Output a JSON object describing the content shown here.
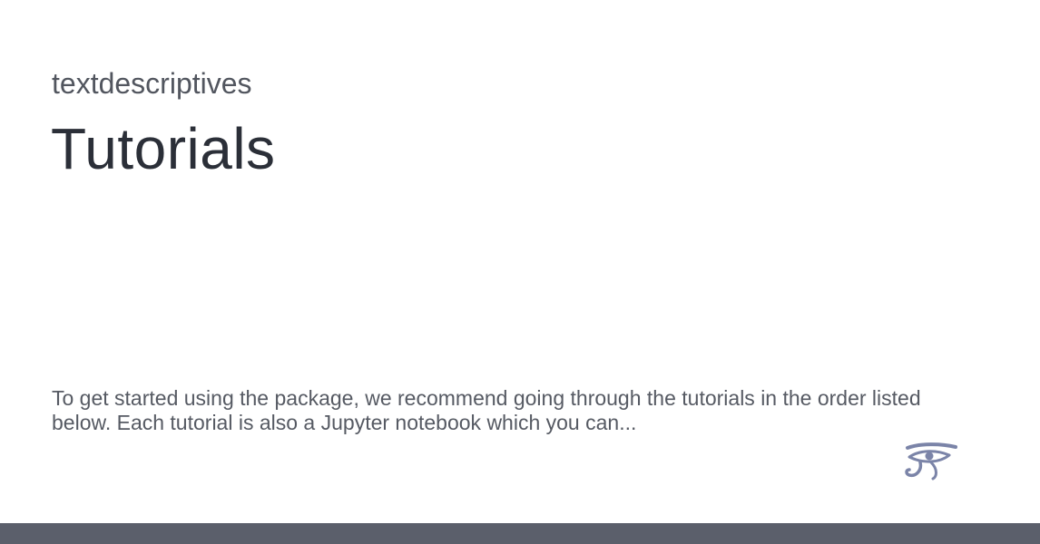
{
  "site": {
    "name": "textdescriptives"
  },
  "page": {
    "title": "Tutorials",
    "description": "To get started using the package, we recommend going through the tutorials in the order listed below. Each tutorial is also a Jupyter notebook which you can..."
  },
  "logo": {
    "icon": "eye-of-horus-icon",
    "color": "#7b84a8"
  },
  "footer": {
    "color": "#5b5f6b"
  }
}
